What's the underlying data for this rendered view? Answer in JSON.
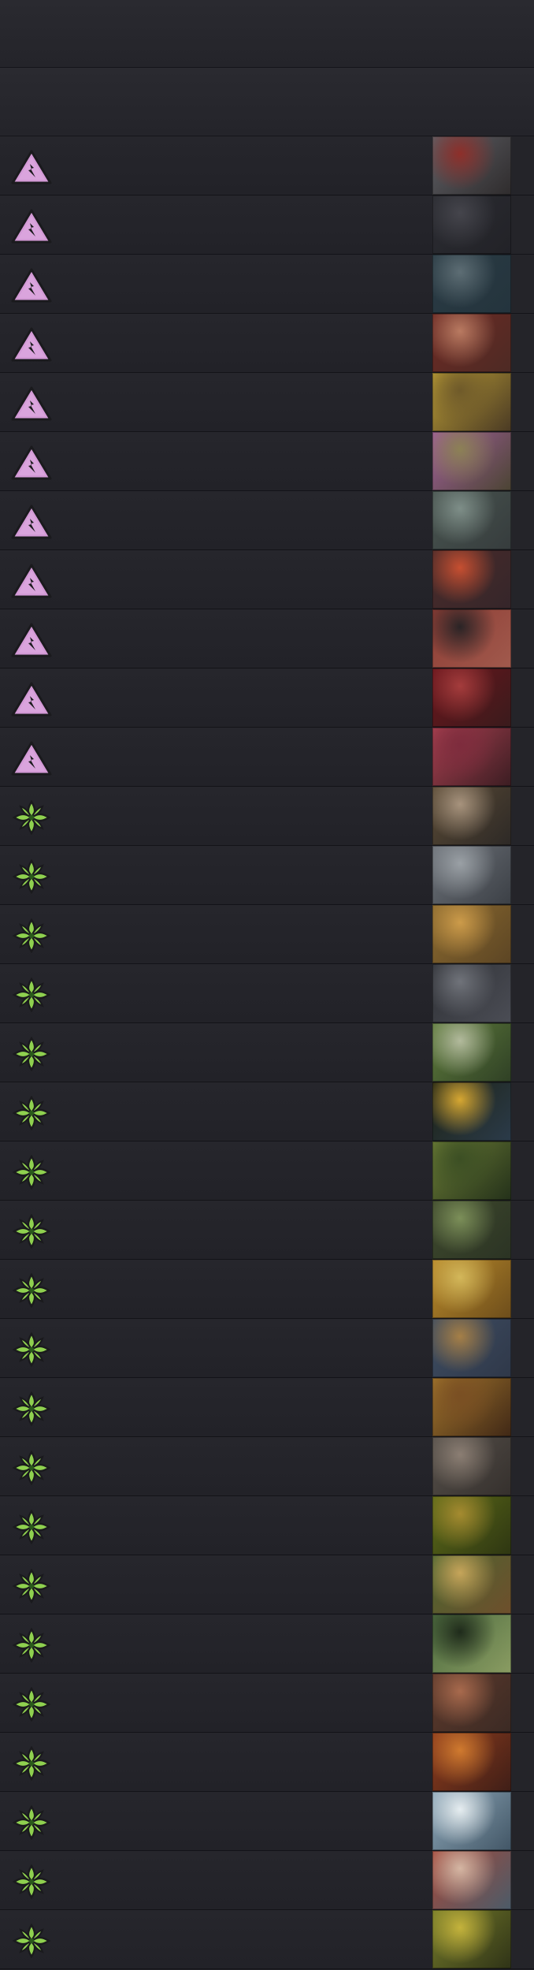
{
  "header": {
    "top_band": "",
    "second_band": ""
  },
  "icons": {
    "purple": {
      "name": "mountain-triangle-icon",
      "fill": "#d39ad6",
      "stroke": "#1a1a1d"
    },
    "green": {
      "name": "green-leaf-cross-icon",
      "fill": "#8fd14f",
      "stroke": "#1a1a1d"
    }
  },
  "rows": [
    {
      "icon": "purple",
      "thumb_gradient": [
        "#5f6066",
        "#8e2f2a",
        "#2f2c2d"
      ],
      "label": ""
    },
    {
      "icon": "purple",
      "thumb_gradient": [
        "#2b2c32",
        "#45454c",
        "#222227"
      ],
      "label": ""
    },
    {
      "icon": "purple",
      "thumb_gradient": [
        "#2a3b44",
        "#5d6d74",
        "#24343d"
      ],
      "label": ""
    },
    {
      "icon": "purple",
      "thumb_gradient": [
        "#6d2a24",
        "#b97a61",
        "#4d2a24"
      ],
      "label": ""
    },
    {
      "icon": "purple",
      "thumb_gradient": [
        "#b89b35",
        "#6f5a2a",
        "#4a3a24"
      ],
      "label": ""
    },
    {
      "icon": "purple",
      "thumb_gradient": [
        "#a15f9a",
        "#8c8155",
        "#4b4433"
      ],
      "label": ""
    },
    {
      "icon": "purple",
      "thumb_gradient": [
        "#495550",
        "#7e8e88",
        "#363c3d"
      ],
      "label": ""
    },
    {
      "icon": "purple",
      "thumb_gradient": [
        "#4a2b2a",
        "#c64f31",
        "#35262a"
      ],
      "label": ""
    },
    {
      "icon": "purple",
      "thumb_gradient": [
        "#8d3c34",
        "#2a2426",
        "#a15a4d"
      ],
      "label": ""
    },
    {
      "icon": "purple",
      "thumb_gradient": [
        "#6a151c",
        "#a43c3c",
        "#3a1b1c"
      ],
      "label": ""
    },
    {
      "icon": "purple",
      "thumb_gradient": [
        "#a84050",
        "#7e2c3d",
        "#3b1d22"
      ],
      "label": ""
    },
    {
      "icon": "green",
      "thumb_gradient": [
        "#5a4a35",
        "#a7937d",
        "#2d2926"
      ],
      "label": ""
    },
    {
      "icon": "green",
      "thumb_gradient": [
        "#6d7279",
        "#9aa0a5",
        "#3c4046"
      ],
      "label": ""
    },
    {
      "icon": "green",
      "thumb_gradient": [
        "#8b6a2f",
        "#cc9b4a",
        "#5c4524"
      ],
      "label": ""
    },
    {
      "icon": "green",
      "thumb_gradient": [
        "#2f3136",
        "#70737a",
        "#4b4d55"
      ],
      "label": ""
    },
    {
      "icon": "green",
      "thumb_gradient": [
        "#5f7c3c",
        "#b2ba9c",
        "#2f4025"
      ],
      "label": ""
    },
    {
      "icon": "green",
      "thumb_gradient": [
        "#1d2214",
        "#d6a732",
        "#2b3b4a"
      ],
      "label": ""
    },
    {
      "icon": "green",
      "thumb_gradient": [
        "#6a7b35",
        "#3c4f24",
        "#24311a"
      ],
      "label": ""
    },
    {
      "icon": "green",
      "thumb_gradient": [
        "#3f4a2d",
        "#7c8f59",
        "#2b3324"
      ],
      "label": ""
    },
    {
      "icon": "green",
      "thumb_gradient": [
        "#b98a2a",
        "#d3b75a",
        "#6d4d1b"
      ],
      "label": ""
    },
    {
      "icon": "green",
      "thumb_gradient": [
        "#3e4d62",
        "#a57f47",
        "#2f3849"
      ],
      "label": ""
    },
    {
      "icon": "green",
      "thumb_gradient": [
        "#a0742c",
        "#7a4f23",
        "#402816"
      ],
      "label": ""
    },
    {
      "icon": "green",
      "thumb_gradient": [
        "#56504a",
        "#8b7e73",
        "#35302d"
      ],
      "label": ""
    },
    {
      "icon": "green",
      "thumb_gradient": [
        "#5d6b18",
        "#a58b30",
        "#2e3612"
      ],
      "label": ""
    },
    {
      "icon": "green",
      "thumb_gradient": [
        "#4c6530",
        "#c6a55a",
        "#6e4f2c"
      ],
      "label": ""
    },
    {
      "icon": "green",
      "thumb_gradient": [
        "#4b6a3e",
        "#1f2b1b",
        "#8a9c62"
      ],
      "label": ""
    },
    {
      "icon": "green",
      "thumb_gradient": [
        "#5e3a2c",
        "#a86a4d",
        "#3b2a24"
      ],
      "label": ""
    },
    {
      "icon": "green",
      "thumb_gradient": [
        "#8f3d1d",
        "#d07a2f",
        "#3f1e17"
      ],
      "label": ""
    },
    {
      "icon": "green",
      "thumb_gradient": [
        "#8ea8b9",
        "#e6edf0",
        "#425666"
      ],
      "label": ""
    },
    {
      "icon": "green",
      "thumb_gradient": [
        "#a5493b",
        "#d5b6a3",
        "#4b5b68"
      ],
      "label": ""
    },
    {
      "icon": "green",
      "thumb_gradient": [
        "#767c2a",
        "#c4b33c",
        "#2f3317"
      ],
      "label": ""
    }
  ]
}
